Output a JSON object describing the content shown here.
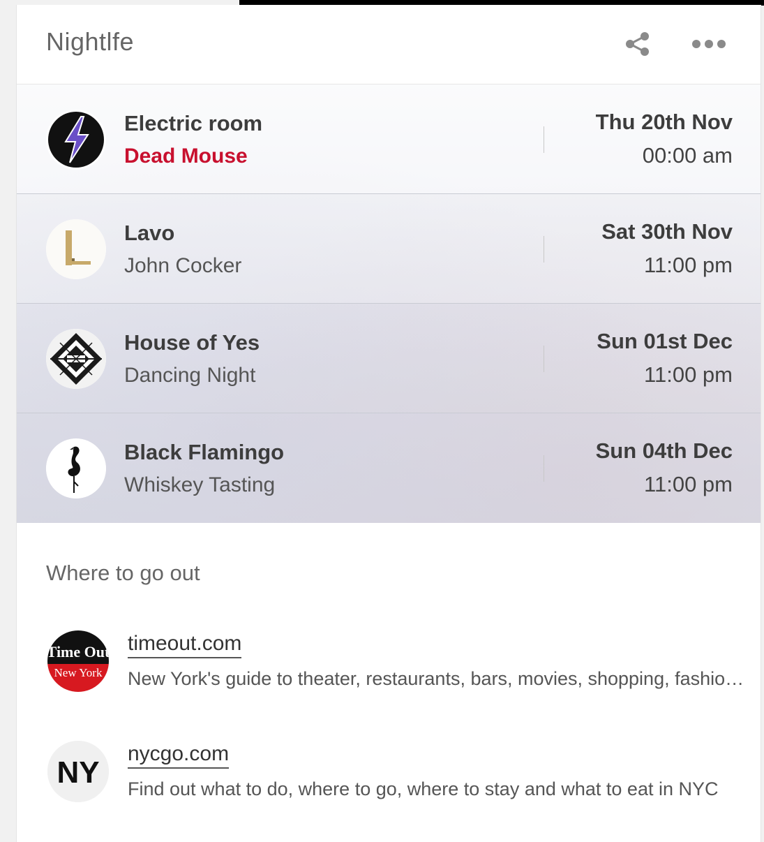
{
  "header": {
    "title": "Nightlfe",
    "share_icon": "share-icon",
    "more_icon": "more-options-icon"
  },
  "events": [
    {
      "venue": "Electric room",
      "act": "Dead Mouse",
      "date": "Thu 20th Nov",
      "time": "00:00 am",
      "logo": "lightning-bolt-logo",
      "act_color": "#c8102e"
    },
    {
      "venue": "Lavo",
      "act": "John Cocker",
      "date": "Sat 30th Nov",
      "time": "11:00 pm",
      "logo": "lavo-l-logo"
    },
    {
      "venue": "House of Yes",
      "act": "Dancing Night",
      "date": "Sun 01st Dec",
      "time": "11:00 pm",
      "logo": "geometric-diamond-logo"
    },
    {
      "venue": "Black Flamingo",
      "act": "Whiskey Tasting",
      "date": "Sun 04th Dec",
      "time": "11:00 pm",
      "logo": "flamingo-logo"
    }
  ],
  "where_to_go": {
    "title": "Where to go out",
    "sites": [
      {
        "name": "timeout.com",
        "description": "New York's guide to theater, restaurants, bars, movies, shopping, fashion and more",
        "logo": "timeout-new-york-logo",
        "logo_text": [
          "Time Out",
          "New York"
        ]
      },
      {
        "name": "nycgo.com",
        "description": "Find out what to do, where to go, where to stay and what to eat in NYC",
        "logo": "ny-logo",
        "logo_text": [
          "NY"
        ]
      }
    ]
  }
}
